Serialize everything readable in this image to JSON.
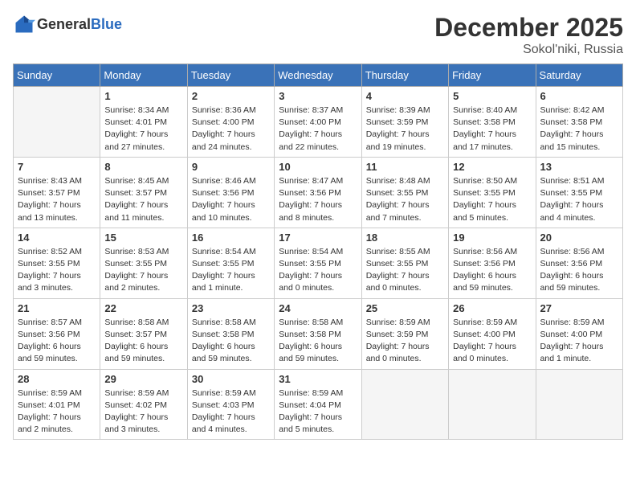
{
  "header": {
    "logo_general": "General",
    "logo_blue": "Blue",
    "month": "December 2025",
    "location": "Sokol'niki, Russia"
  },
  "days_of_week": [
    "Sunday",
    "Monday",
    "Tuesday",
    "Wednesday",
    "Thursday",
    "Friday",
    "Saturday"
  ],
  "weeks": [
    [
      {
        "day": "",
        "info": ""
      },
      {
        "day": "1",
        "info": "Sunrise: 8:34 AM\nSunset: 4:01 PM\nDaylight: 7 hours\nand 27 minutes."
      },
      {
        "day": "2",
        "info": "Sunrise: 8:36 AM\nSunset: 4:00 PM\nDaylight: 7 hours\nand 24 minutes."
      },
      {
        "day": "3",
        "info": "Sunrise: 8:37 AM\nSunset: 4:00 PM\nDaylight: 7 hours\nand 22 minutes."
      },
      {
        "day": "4",
        "info": "Sunrise: 8:39 AM\nSunset: 3:59 PM\nDaylight: 7 hours\nand 19 minutes."
      },
      {
        "day": "5",
        "info": "Sunrise: 8:40 AM\nSunset: 3:58 PM\nDaylight: 7 hours\nand 17 minutes."
      },
      {
        "day": "6",
        "info": "Sunrise: 8:42 AM\nSunset: 3:58 PM\nDaylight: 7 hours\nand 15 minutes."
      }
    ],
    [
      {
        "day": "7",
        "info": "Sunrise: 8:43 AM\nSunset: 3:57 PM\nDaylight: 7 hours\nand 13 minutes."
      },
      {
        "day": "8",
        "info": "Sunrise: 8:45 AM\nSunset: 3:57 PM\nDaylight: 7 hours\nand 11 minutes."
      },
      {
        "day": "9",
        "info": "Sunrise: 8:46 AM\nSunset: 3:56 PM\nDaylight: 7 hours\nand 10 minutes."
      },
      {
        "day": "10",
        "info": "Sunrise: 8:47 AM\nSunset: 3:56 PM\nDaylight: 7 hours\nand 8 minutes."
      },
      {
        "day": "11",
        "info": "Sunrise: 8:48 AM\nSunset: 3:55 PM\nDaylight: 7 hours\nand 7 minutes."
      },
      {
        "day": "12",
        "info": "Sunrise: 8:50 AM\nSunset: 3:55 PM\nDaylight: 7 hours\nand 5 minutes."
      },
      {
        "day": "13",
        "info": "Sunrise: 8:51 AM\nSunset: 3:55 PM\nDaylight: 7 hours\nand 4 minutes."
      }
    ],
    [
      {
        "day": "14",
        "info": "Sunrise: 8:52 AM\nSunset: 3:55 PM\nDaylight: 7 hours\nand 3 minutes."
      },
      {
        "day": "15",
        "info": "Sunrise: 8:53 AM\nSunset: 3:55 PM\nDaylight: 7 hours\nand 2 minutes."
      },
      {
        "day": "16",
        "info": "Sunrise: 8:54 AM\nSunset: 3:55 PM\nDaylight: 7 hours\nand 1 minute."
      },
      {
        "day": "17",
        "info": "Sunrise: 8:54 AM\nSunset: 3:55 PM\nDaylight: 7 hours\nand 0 minutes."
      },
      {
        "day": "18",
        "info": "Sunrise: 8:55 AM\nSunset: 3:55 PM\nDaylight: 7 hours\nand 0 minutes."
      },
      {
        "day": "19",
        "info": "Sunrise: 8:56 AM\nSunset: 3:56 PM\nDaylight: 6 hours\nand 59 minutes."
      },
      {
        "day": "20",
        "info": "Sunrise: 8:56 AM\nSunset: 3:56 PM\nDaylight: 6 hours\nand 59 minutes."
      }
    ],
    [
      {
        "day": "21",
        "info": "Sunrise: 8:57 AM\nSunset: 3:56 PM\nDaylight: 6 hours\nand 59 minutes."
      },
      {
        "day": "22",
        "info": "Sunrise: 8:58 AM\nSunset: 3:57 PM\nDaylight: 6 hours\nand 59 minutes."
      },
      {
        "day": "23",
        "info": "Sunrise: 8:58 AM\nSunset: 3:58 PM\nDaylight: 6 hours\nand 59 minutes."
      },
      {
        "day": "24",
        "info": "Sunrise: 8:58 AM\nSunset: 3:58 PM\nDaylight: 6 hours\nand 59 minutes."
      },
      {
        "day": "25",
        "info": "Sunrise: 8:59 AM\nSunset: 3:59 PM\nDaylight: 7 hours\nand 0 minutes."
      },
      {
        "day": "26",
        "info": "Sunrise: 8:59 AM\nSunset: 4:00 PM\nDaylight: 7 hours\nand 0 minutes."
      },
      {
        "day": "27",
        "info": "Sunrise: 8:59 AM\nSunset: 4:00 PM\nDaylight: 7 hours\nand 1 minute."
      }
    ],
    [
      {
        "day": "28",
        "info": "Sunrise: 8:59 AM\nSunset: 4:01 PM\nDaylight: 7 hours\nand 2 minutes."
      },
      {
        "day": "29",
        "info": "Sunrise: 8:59 AM\nSunset: 4:02 PM\nDaylight: 7 hours\nand 3 minutes."
      },
      {
        "day": "30",
        "info": "Sunrise: 8:59 AM\nSunset: 4:03 PM\nDaylight: 7 hours\nand 4 minutes."
      },
      {
        "day": "31",
        "info": "Sunrise: 8:59 AM\nSunset: 4:04 PM\nDaylight: 7 hours\nand 5 minutes."
      },
      {
        "day": "",
        "info": ""
      },
      {
        "day": "",
        "info": ""
      },
      {
        "day": "",
        "info": ""
      }
    ]
  ]
}
